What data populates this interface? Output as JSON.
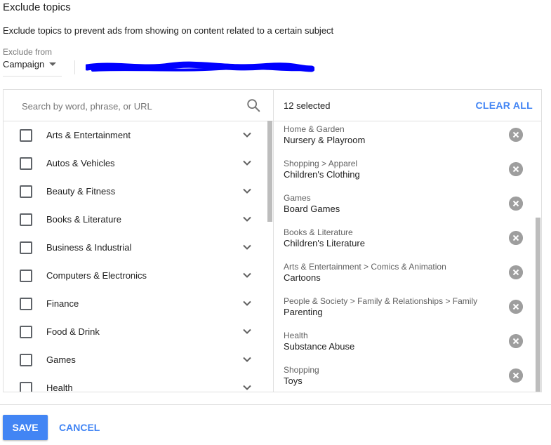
{
  "title": "Exclude topics",
  "subtitle": "Exclude topics to prevent ads from showing on content related to a certain subject",
  "exclude_from": {
    "label": "Exclude from",
    "value": "Campaign"
  },
  "search": {
    "placeholder": "Search by word, phrase, or URL"
  },
  "categories": [
    {
      "label": "Arts & Entertainment"
    },
    {
      "label": "Autos & Vehicles"
    },
    {
      "label": "Beauty & Fitness"
    },
    {
      "label": "Books & Literature"
    },
    {
      "label": "Business & Industrial"
    },
    {
      "label": "Computers & Electronics"
    },
    {
      "label": "Finance"
    },
    {
      "label": "Food & Drink"
    },
    {
      "label": "Games"
    },
    {
      "label": "Health"
    }
  ],
  "selected": {
    "count_label": "12 selected",
    "clear_all": "CLEAR ALL",
    "items": [
      {
        "path": "Home & Garden",
        "name": "Nursery & Playroom"
      },
      {
        "path": "Shopping > Apparel",
        "name": "Children's Clothing"
      },
      {
        "path": "Games",
        "name": "Board Games"
      },
      {
        "path": "Books & Literature",
        "name": "Children's Literature"
      },
      {
        "path": "Arts & Entertainment > Comics & Animation",
        "name": "Cartoons"
      },
      {
        "path": "People & Society > Family & Relationships > Family",
        "name": "Parenting"
      },
      {
        "path": "Health",
        "name": "Substance Abuse"
      },
      {
        "path": "Shopping",
        "name": "Toys"
      }
    ]
  },
  "footer": {
    "save": "SAVE",
    "cancel": "CANCEL"
  },
  "colors": {
    "accent": "#4285f4",
    "redaction": "#0000ff",
    "remove_icon": "#9e9e9e"
  }
}
